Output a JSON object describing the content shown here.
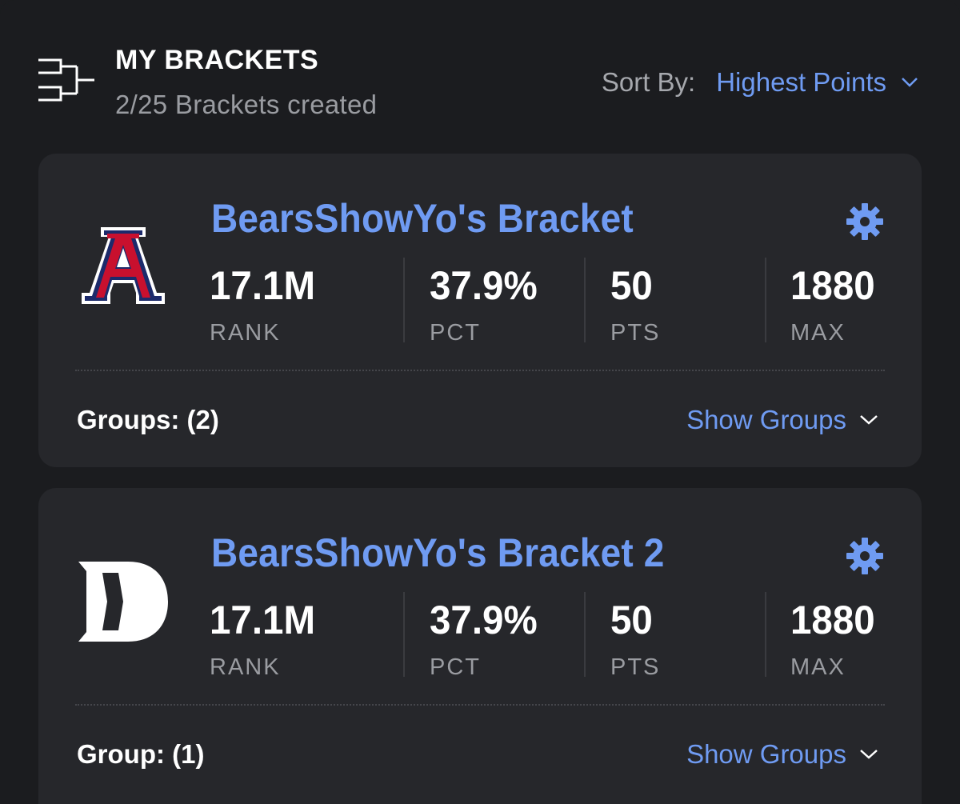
{
  "header": {
    "title": "MY BRACKETS",
    "subtitle": "2/25 Brackets created",
    "sort_label": "Sort By:",
    "sort_value": "Highest Points",
    "icon": "bracket-icon"
  },
  "colors": {
    "accent": "#6f9bf2",
    "background": "#1b1c1f",
    "card": "#26272b",
    "muted_text": "#9a9ca1"
  },
  "brackets": [
    {
      "name": "BearsShowYo's Bracket",
      "logo": "arizona-logo",
      "stats": [
        {
          "value": "17.1M",
          "label": "RANK"
        },
        {
          "value": "37.9%",
          "label": "PCT"
        },
        {
          "value": "50",
          "label": "PTS"
        },
        {
          "value": "1880",
          "label": "MAX"
        }
      ],
      "groups_label": "Groups: (2)",
      "show_groups": "Show Groups"
    },
    {
      "name": "BearsShowYo's Bracket 2",
      "logo": "duke-logo",
      "stats": [
        {
          "value": "17.1M",
          "label": "RANK"
        },
        {
          "value": "37.9%",
          "label": "PCT"
        },
        {
          "value": "50",
          "label": "PTS"
        },
        {
          "value": "1880",
          "label": "MAX"
        }
      ],
      "groups_label": "Group: (1)",
      "show_groups": "Show Groups"
    }
  ]
}
